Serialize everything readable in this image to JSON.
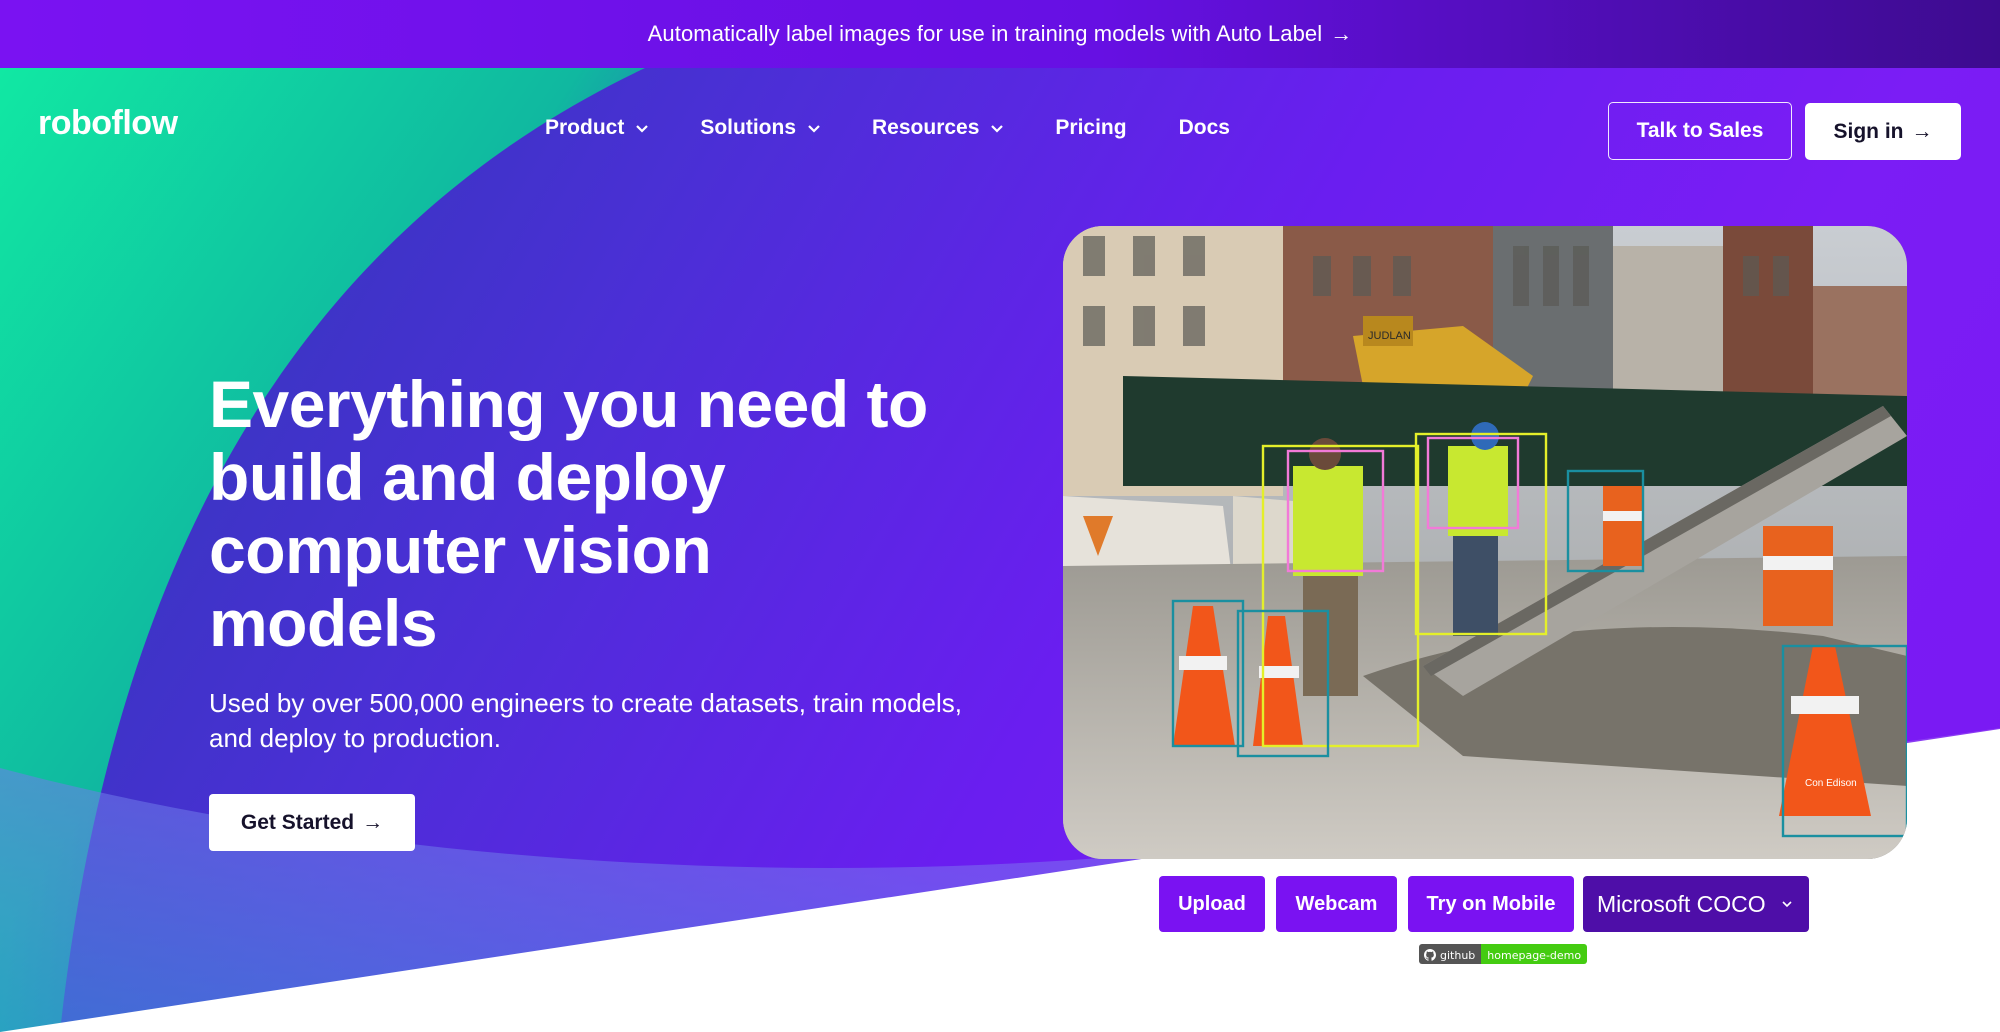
{
  "announcement": {
    "text": "Automatically label images for use in training models with Auto Label",
    "arrow": "→"
  },
  "header": {
    "logo": "roboflow",
    "nav": [
      {
        "label": "Product",
        "has_dropdown": true
      },
      {
        "label": "Solutions",
        "has_dropdown": true
      },
      {
        "label": "Resources",
        "has_dropdown": true
      },
      {
        "label": "Pricing",
        "has_dropdown": false
      },
      {
        "label": "Docs",
        "has_dropdown": false
      }
    ],
    "talk_to_sales": "Talk to Sales",
    "sign_in": "Sign in",
    "arrow": "→"
  },
  "hero": {
    "headline": "Everything you need to build and deploy computer vision models",
    "subheadline": "Used by over 500,000 engineers to create datasets, train models, and deploy to production.",
    "cta": "Get Started",
    "arrow": "→"
  },
  "demo": {
    "buttons": {
      "upload": "Upload",
      "webcam": "Webcam",
      "mobile": "Try on Mobile"
    },
    "model_select": "Microsoft COCO",
    "badge": {
      "left": "github",
      "right": "homepage-demo"
    },
    "scene_texts": {
      "sign_brand": "JUDLAN",
      "cone_brand": "Con Edison"
    }
  },
  "colors": {
    "primary_purple": "#7a12f2",
    "dark_purple": "#4e0ea8",
    "green": "#17e59a",
    "box_yellow": "#e4ef2a",
    "box_pink": "#f27ad8",
    "box_teal": "#1a8fa0"
  }
}
